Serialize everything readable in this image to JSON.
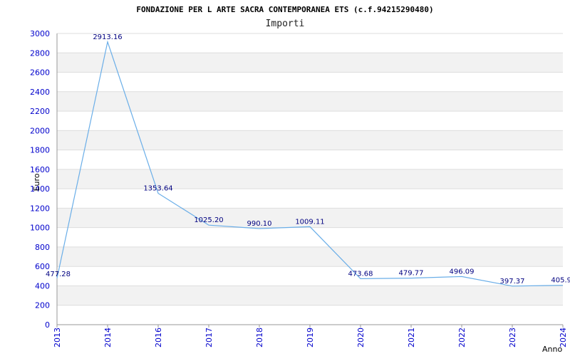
{
  "chart_data": {
    "type": "line",
    "title": "FONDAZIONE PER L ARTE SACRA CONTEMPORANEA ETS (c.f.94215290480)",
    "subtitle": "Importi",
    "xlabel": "Anno",
    "ylabel": "Euro",
    "categories": [
      "2013",
      "2014",
      "2016",
      "2017",
      "2018",
      "2019",
      "2020",
      "2021",
      "2022",
      "2023",
      "2024"
    ],
    "values": [
      477.28,
      2913.16,
      1353.64,
      1025.2,
      990.1,
      1009.11,
      473.68,
      479.77,
      496.09,
      397.37,
      405.9
    ],
    "value_labels": [
      "477.28",
      "2913.16",
      "1353.64",
      "1025.20",
      "990.10",
      "1009.11",
      "473.68",
      "479.77",
      "496.09",
      "397.37",
      "405.9"
    ],
    "ylim": [
      0,
      3000
    ],
    "yticks": [
      "0",
      "200",
      "400",
      "600",
      "800",
      "1000",
      "1200",
      "1400",
      "1600",
      "1800",
      "2000",
      "2200",
      "2400",
      "2600",
      "2800",
      "3000"
    ],
    "grid": true,
    "colors": {
      "line": "#6aaee8",
      "band": "#f2f2f2",
      "grid": "#dddddd",
      "tick_text": "#0000cc",
      "label_text": "#000080"
    }
  }
}
